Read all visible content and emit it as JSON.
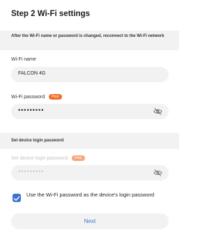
{
  "header": {
    "title": "Step 2 Wi-Fi settings"
  },
  "notice": {
    "text": "After the Wi-Fi name or password is changed, reconnect to the Wi-Fi network"
  },
  "wifi_name": {
    "label": "Wi-Fi name",
    "value": "FALCON 4G"
  },
  "wifi_password": {
    "label": "Wi-Fi password",
    "strength_badge": "Poor",
    "value": "•••••••••",
    "visibility_icon": "eye-hidden-icon"
  },
  "login_section": {
    "title": "Set device login password"
  },
  "login_password": {
    "label": "Set device login password",
    "strength_badge": "Poor",
    "value": "•••••••••",
    "visibility_icon": "eye-hidden-icon",
    "disabled": true
  },
  "use_wifi_password": {
    "checked": true,
    "label": "Use the Wi-Fi password as the device's login password"
  },
  "actions": {
    "next_label": "Next"
  },
  "colors": {
    "accent": "#3d71ce",
    "badge": "#f16c2b",
    "field_bg": "#f2f2f2"
  }
}
